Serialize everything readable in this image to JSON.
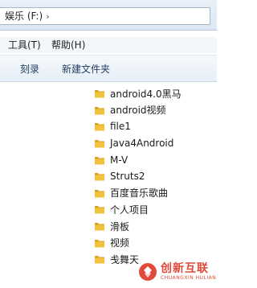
{
  "address": {
    "path": "娱乐 (F:)",
    "separator_glyph": "›"
  },
  "menu": {
    "items": [
      "工具(T)",
      "帮助(H)"
    ]
  },
  "toolbar": {
    "burn_label": "刻录",
    "new_folder_label": "新建文件夹"
  },
  "files": [
    {
      "name": "android4.0黑马",
      "icon": "folder-icon"
    },
    {
      "name": "android视频",
      "icon": "folder-icon"
    },
    {
      "name": "file1",
      "icon": "folder-icon"
    },
    {
      "name": "Java4Android",
      "icon": "folder-icon"
    },
    {
      "name": "M-V",
      "icon": "folder-icon"
    },
    {
      "name": "Struts2",
      "icon": "folder-icon"
    },
    {
      "name": "百度音乐歌曲",
      "icon": "folder-icon"
    },
    {
      "name": "个人项目",
      "icon": "folder-icon"
    },
    {
      "name": "滑板",
      "icon": "folder-icon"
    },
    {
      "name": "视频",
      "icon": "folder-icon"
    },
    {
      "name": "戋舞天",
      "icon": "folder-icon"
    }
  ],
  "watermark": {
    "main": "创新互联",
    "sub": "CHUANGXIN HULIAN"
  },
  "colors": {
    "folder": "#f2c23e",
    "folder_dark": "#d9a21f",
    "watermark": "#e04a3a",
    "command_text": "#1e3b5e"
  }
}
